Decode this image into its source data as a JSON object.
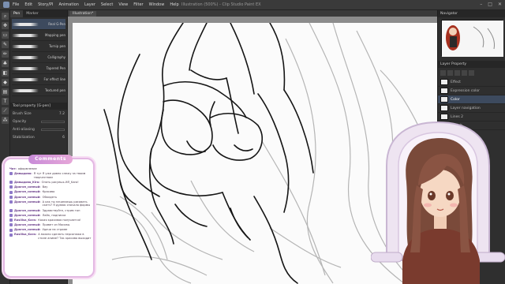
{
  "window": {
    "title": "Illustration (500%) - Clip Studio Paint EX"
  },
  "menu": {
    "items": [
      "File",
      "Edit",
      "Story/PI",
      "Animation",
      "Layer",
      "Select",
      "View",
      "Filter",
      "Window",
      "Help"
    ]
  },
  "left_panel": {
    "tabs": [
      "Pen",
      "Marker"
    ],
    "brushes": [
      {
        "name": "Real G-Pen"
      },
      {
        "name": "Mapping pen"
      },
      {
        "name": "Turnip pen"
      },
      {
        "name": "Calligraphy"
      },
      {
        "name": "Tapered Pen"
      },
      {
        "name": "For effect line"
      },
      {
        "name": "Textured pen"
      }
    ],
    "properties_title": "Tool property [G-pen]",
    "properties": [
      {
        "label": "Brush Size",
        "value": "7.2"
      },
      {
        "label": "Opacity",
        "value": "100"
      },
      {
        "label": "Anti-aliasing",
        "value": ""
      },
      {
        "label": "Stabilization",
        "value": "6"
      }
    ]
  },
  "canvas": {
    "tab_label": "Illustration*"
  },
  "right_panel": {
    "navigator_title": "Navigator",
    "layer_panel_title": "Layer Property",
    "layers": [
      {
        "name": "Effect"
      },
      {
        "name": "Expression color"
      },
      {
        "name": "Color"
      },
      {
        "name": "Layer navigation"
      },
      {
        "name": "Lines 2"
      },
      {
        "name": "Sketch"
      }
    ]
  },
  "chat": {
    "title": "Comments",
    "messages": [
      {
        "user": "Чат:",
        "text": "оформление"
      },
      {
        "user": "Давыдова:",
        "text": "Я тут Я уже давно слежу за твоим творчеством"
      },
      {
        "user": "Давыдова_Kira:",
        "text": "Опять рисуешь ИЛ_Kara!"
      },
      {
        "user": "Драгон_сонный:",
        "text": "Вау"
      },
      {
        "user": "Драгон_сонный:",
        "text": "Красиво"
      },
      {
        "user": "Драгон_сонный:",
        "text": "Обалдеть"
      },
      {
        "user": "Драгон_сонный:",
        "text": "А как ты начинаешь рисовать скетч? Я думаю сначала формы"
      },
      {
        "user": "Драгон_сонный:",
        "text": "Здравствуйте, стрим топ"
      },
      {
        "user": "Драгон_сонный:",
        "text": "Лайк, подписка"
      },
      {
        "user": "Rasilisa_Kara:",
        "text": "Какая красивая получается!"
      },
      {
        "user": "Драгон_сонный:",
        "text": "Привет из Москвы"
      },
      {
        "user": "Драгон_сонный:",
        "text": "Удачи на стриме"
      },
      {
        "user": "Rasilisa_Kara:",
        "text": "А можно сделать персонажа в стиле аниме? Так красиво выходит"
      }
    ]
  }
}
